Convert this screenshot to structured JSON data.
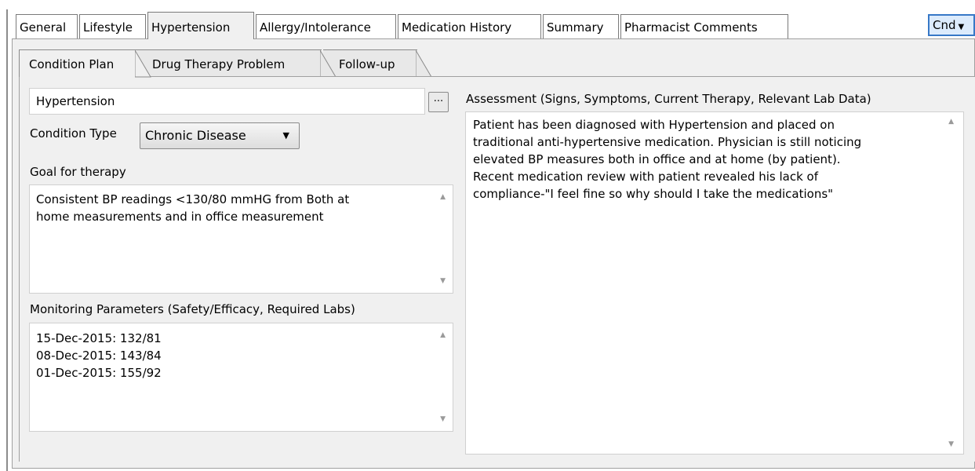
{
  "tabs": [
    {
      "label": "General",
      "active": false
    },
    {
      "label": "Lifestyle",
      "active": false
    },
    {
      "label": "Hypertension",
      "active": true
    },
    {
      "label": "Allergy/Intolerance",
      "active": false
    },
    {
      "label": "Medication History",
      "active": false
    },
    {
      "label": "Summary",
      "active": false
    },
    {
      "label": "Pharmacist Comments",
      "active": false
    }
  ],
  "cnd_button": {
    "label": "Cnd",
    "icon": "chevron-down-icon"
  },
  "subtabs": [
    {
      "label": "Condition Plan",
      "active": true
    },
    {
      "label": "Drug Therapy Problem",
      "active": false
    },
    {
      "label": "Follow-up",
      "active": false
    }
  ],
  "condition": {
    "name_value": "Hypertension",
    "browse_label": "...",
    "type_label": "Condition Type",
    "type_value": "Chronic Disease"
  },
  "goal": {
    "label": "Goal for therapy",
    "text": "Consistent BP readings <130/80 mmHG from Both at\nhome measurements and in office measurement"
  },
  "monitoring": {
    "label": "Monitoring Parameters (Safety/Efficacy, Required Labs)",
    "text": "15-Dec-2015: 132/81\n08-Dec-2015: 143/84\n01-Dec-2015: 155/92"
  },
  "assessment": {
    "label": "Assessment (Signs, Symptoms, Current Therapy, Relevant Lab Data)",
    "text": "Patient has been diagnosed with Hypertension and placed on\ntraditional anti-hypertensive medication.  Physician is still noticing\nelevated BP measures both in office and at home (by patient).\nRecent medication review with patient revealed his lack of\ncompliance-\"I feel fine so why should I take the medications\""
  },
  "colors": {
    "accent": "#3778c7",
    "panel": "#f0f0f0",
    "border": "#a0a0a0"
  }
}
